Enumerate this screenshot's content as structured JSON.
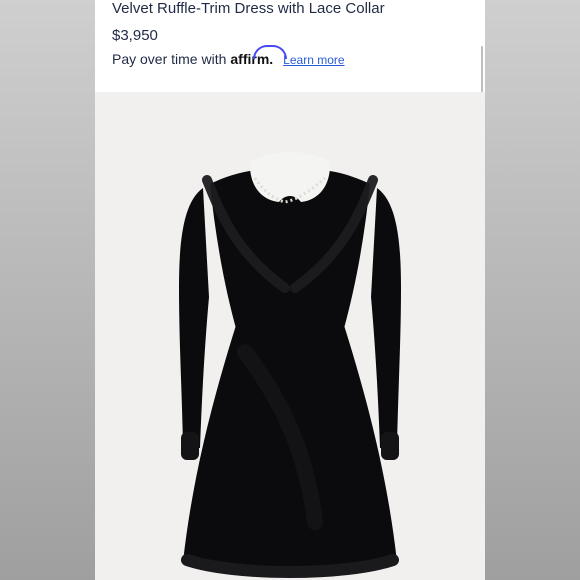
{
  "product": {
    "title": "Velvet Ruffle-Trim Dress with Lace Collar",
    "price": "$3,950"
  },
  "financing": {
    "prefix": "Pay over time with",
    "brand": "affirm",
    "suffix": ".",
    "link_label": "Learn more"
  },
  "image": {
    "subject": "dress-image",
    "colors": {
      "dress": "#0b0b0d",
      "collar": "#f4f4f2",
      "background": "#f1f0ee",
      "accent": "#4a4af4"
    }
  }
}
